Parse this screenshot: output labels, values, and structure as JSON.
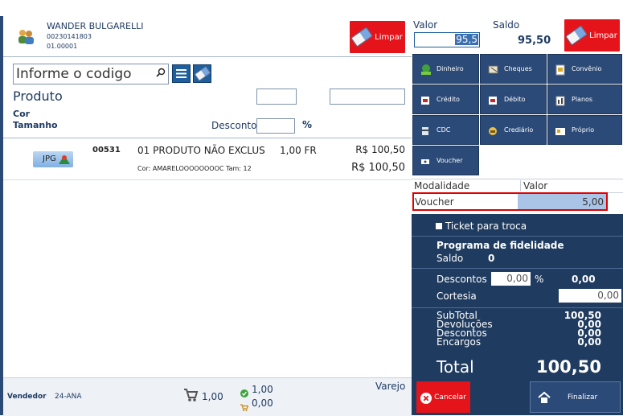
{
  "customer": {
    "name": "WANDER BULGARELLI",
    "code": "00230141803",
    "store": "01.00001"
  },
  "left_clear_label": "Limpar",
  "search": {
    "placeholder": "Informe o codigo"
  },
  "product_form": {
    "product_label": "Produto",
    "color_label": "Cor",
    "size_label": "Tamanho",
    "discount_label": "Desconto",
    "percent_symbol": "%"
  },
  "item": {
    "thumb_label": "JPG",
    "code": "00531",
    "description": "01 PRODUTO NÃO EXCLUS",
    "quantity": "1,00 FR",
    "unit_price": "R$ 100,50",
    "variant": "Cor: AMARELOOOOOOOOC Tam: 12",
    "total": "R$ 100,50"
  },
  "footer": {
    "seller_label": "Vendedor",
    "seller_value": "24-ANA",
    "cart_qty": "1,00",
    "ok_qty": "1,00",
    "returns_qty": "0,00",
    "sale_type": "Varejo"
  },
  "payment_header": {
    "value_label": "Valor",
    "value_input": "95,5",
    "balance_label": "Saldo",
    "balance_value": "95,50",
    "clear_label": "Limpar"
  },
  "payment_methods": [
    "Dinheiro",
    "Cheques",
    "Convênio",
    "Crédito",
    "Débito",
    "Planos",
    "CDC",
    "Crediário",
    "Próprio",
    "Voucher"
  ],
  "modality_table": {
    "col_modality": "Modalidade",
    "col_value": "Valor",
    "row_modality": "Voucher",
    "row_value": "5,00"
  },
  "ticket_label": "Ticket para troca",
  "loyalty": {
    "title": "Programa de fidelidade",
    "balance_label": "Saldo",
    "balance_value": "0"
  },
  "discounts": {
    "label": "Descontos",
    "percent_value": "0,00",
    "percent_symbol": "%",
    "value": "0,00",
    "courtesy_label": "Cortesia",
    "courtesy_value": "0,00"
  },
  "summary": {
    "subtotal_label": "SubTotal",
    "subtotal_value": "100,50",
    "returns_label": "Devoluções",
    "returns_value": "0,00",
    "discounts_label": "Descontos",
    "discounts_value": "0,00",
    "charges_label": "Encargos",
    "charges_value": "0,00",
    "total_label": "Total",
    "total_value": "100,50"
  },
  "actions": {
    "cancel_label": "Cancelar",
    "finish_label": "Finalizar"
  },
  "colors": {
    "navy": "#1f3b5f",
    "button_blue": "#2b4a77",
    "red": "#e5141a",
    "selection_red": "#e10000",
    "value_blue": "#a9c4e6"
  }
}
